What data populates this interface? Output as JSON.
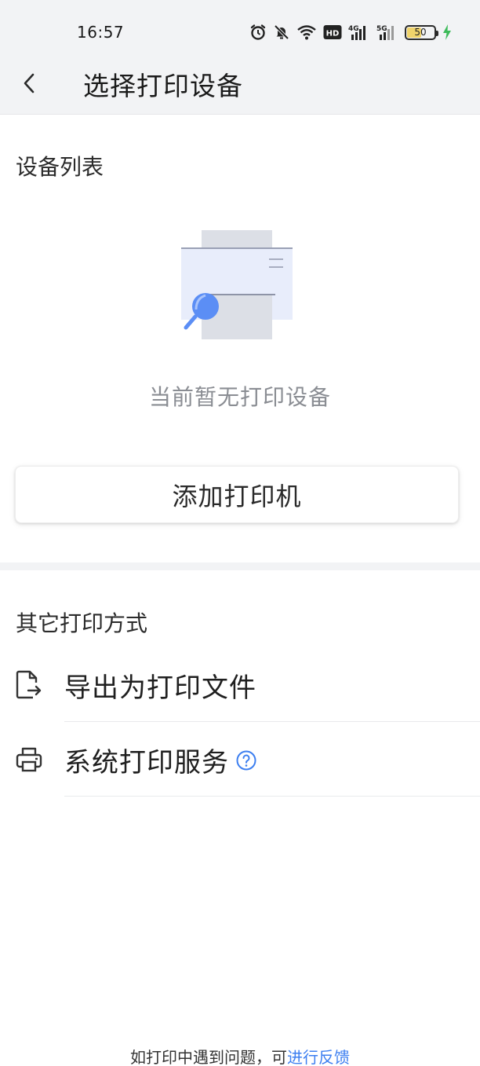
{
  "status_bar": {
    "time": "16:57",
    "battery": "50",
    "network_a": "4G",
    "network_b": "5G",
    "hd_badge": "HD",
    "icons": [
      "alarm-icon",
      "bell-mute-icon",
      "wifi-icon",
      "hd-icon",
      "signal-4g-icon",
      "signal-5g-icon",
      "battery-icon",
      "charging-icon"
    ]
  },
  "header": {
    "title": "选择打印设备"
  },
  "device_list": {
    "section_title": "设备列表",
    "empty_text": "当前暂无打印设备",
    "add_button_label": "添加打印机"
  },
  "other_methods": {
    "section_title": "其它打印方式",
    "items": [
      {
        "label": "导出为打印文件",
        "icon": "export-file-icon"
      },
      {
        "label": "系统打印服务",
        "icon": "printer-icon"
      }
    ]
  },
  "footer": {
    "text": "如打印中遇到问题，可",
    "link": "进行反馈"
  },
  "colors": {
    "accent": "#3d7ff0",
    "header_bg": "#f2f3f5",
    "muted_text": "#8a8d93"
  }
}
